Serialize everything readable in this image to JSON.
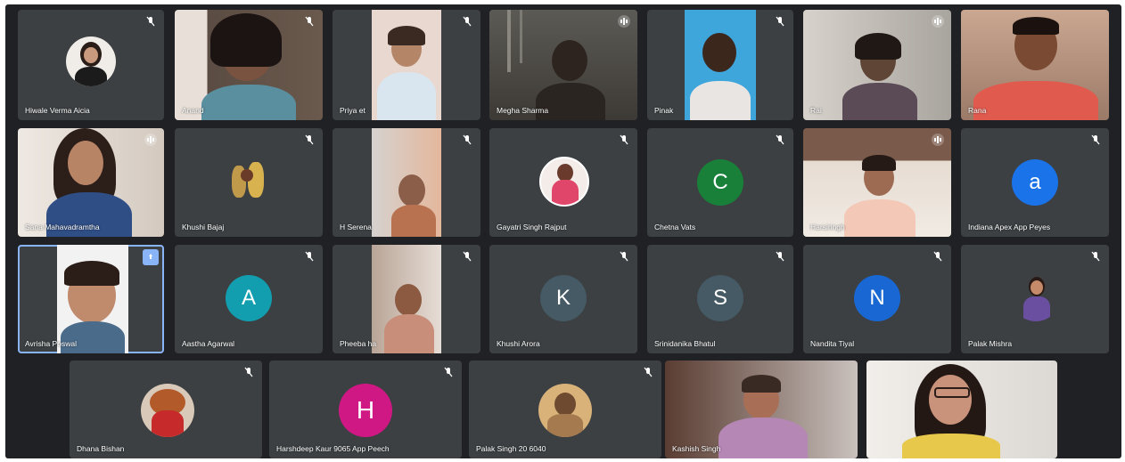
{
  "colors": {
    "background": "#202124",
    "tile": "#3c4043",
    "active_outline": "#8ab4f8"
  },
  "participants": [
    {
      "name": "Hiwale Verma Aicia",
      "kind": "picture-avatar",
      "mic": "muted"
    },
    {
      "name": "    Anand",
      "kind": "video",
      "mic": "muted"
    },
    {
      "name": "Priya            et",
      "kind": "video",
      "mic": "muted"
    },
    {
      "name": "Megha Sharma",
      "kind": "video",
      "mic": "on"
    },
    {
      "name": "Pinak",
      "kind": "video",
      "mic": "muted"
    },
    {
      "name": "        Rai",
      "kind": "video",
      "mic": "on"
    },
    {
      "name": "         Rana",
      "kind": "video",
      "mic": "none"
    },
    {
      "name": "Sana Mahavadramtha",
      "kind": "video",
      "mic": "on"
    },
    {
      "name": "Khushi Bajaj",
      "kind": "picture-avatar",
      "mic": "muted"
    },
    {
      "name": "H Serena",
      "kind": "video",
      "mic": "muted"
    },
    {
      "name": "Gayatri Singh Rajput",
      "kind": "picture-avatar",
      "mic": "muted"
    },
    {
      "name": "Chetna Vats",
      "kind": "letter-avatar",
      "letter": "C",
      "color": "#188038",
      "mic": "muted"
    },
    {
      "name": "Harsiringh",
      "kind": "video",
      "mic": "on"
    },
    {
      "name": "Indiana Apex App Peyes",
      "kind": "letter-avatar",
      "letter": "a",
      "color": "#1a73e8",
      "mic": "muted"
    },
    {
      "name": "Avrisha Poswal",
      "kind": "video",
      "mic": "pinned"
    },
    {
      "name": "Aastha Agarwal",
      "kind": "letter-avatar",
      "letter": "A",
      "color": "#129eaf",
      "mic": "muted"
    },
    {
      "name": "Pheeba     ha",
      "kind": "video",
      "mic": "muted"
    },
    {
      "name": "Khushi Arora",
      "kind": "letter-avatar",
      "letter": "K",
      "color": "#455a64",
      "mic": "muted"
    },
    {
      "name": "Srinidanika Bhatul",
      "kind": "letter-avatar",
      "letter": "S",
      "color": "#455a64",
      "mic": "muted"
    },
    {
      "name": "Nandita Tiyal",
      "kind": "letter-avatar",
      "letter": "N",
      "color": "#1967d2",
      "mic": "muted"
    },
    {
      "name": "Palak Mishra",
      "kind": "picture-avatar",
      "mic": "muted"
    },
    {
      "name": "Dhana Bishan",
      "kind": "picture-avatar",
      "mic": "muted"
    },
    {
      "name": "Harshdeep Kaur 9065 App Peech",
      "kind": "letter-avatar",
      "letter": "H",
      "color": "#d01884",
      "mic": "muted"
    },
    {
      "name": "Palak Singh 20 6040",
      "kind": "picture-avatar",
      "mic": "muted"
    },
    {
      "name": "Kashish Singh",
      "kind": "video",
      "mic": "none"
    },
    {
      "name": "",
      "kind": "video",
      "mic": "none"
    }
  ]
}
